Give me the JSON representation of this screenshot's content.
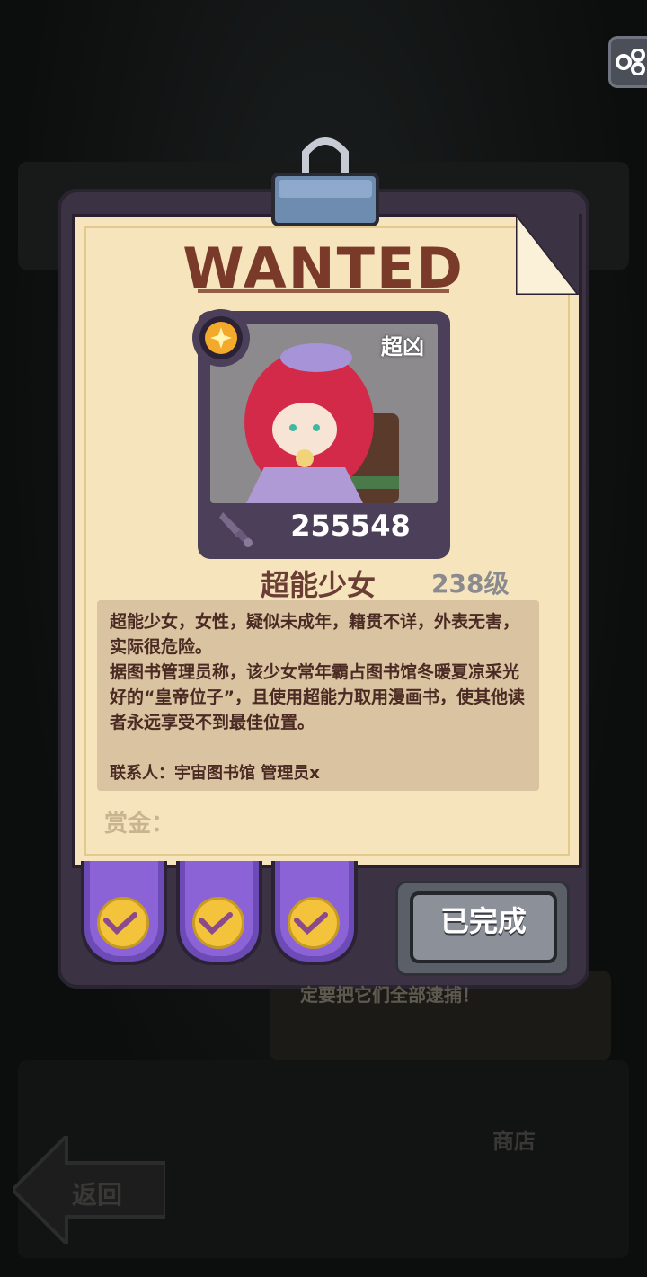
{
  "poster": {
    "title": "WANTED",
    "rank": "超凶",
    "power": "255548",
    "name": "超能少女",
    "level": "238级",
    "description": "超能少女，女性，疑似未成年，籍贯不详，外表无害，实际很危险。\n据图书管理员称，该少女常年霸占图书馆冬暖夏凉采光好的“皇帝位子”，且使用超能力取用漫画书，使其他读者永远享受不到最佳位置。",
    "contact": "联系人：宇宙图书馆 管理员x",
    "bounty_label": "赏金："
  },
  "rewards": [
    {
      "status": "claimed"
    },
    {
      "status": "claimed"
    },
    {
      "status": "claimed"
    }
  ],
  "done_button": {
    "label": "已完成"
  },
  "background": {
    "hint_text": "定要把它们全部逮捕！",
    "back_label": "返回",
    "shop_label": "商店"
  },
  "colors": {
    "paper": "#f6e5bc",
    "title": "#7a3a2a",
    "tab": "#8b63d6",
    "check": "#f3c33c"
  },
  "icons": [
    "link-icon",
    "binder-clip-icon",
    "rank-badge-icon",
    "sword-icon",
    "check-icon"
  ]
}
